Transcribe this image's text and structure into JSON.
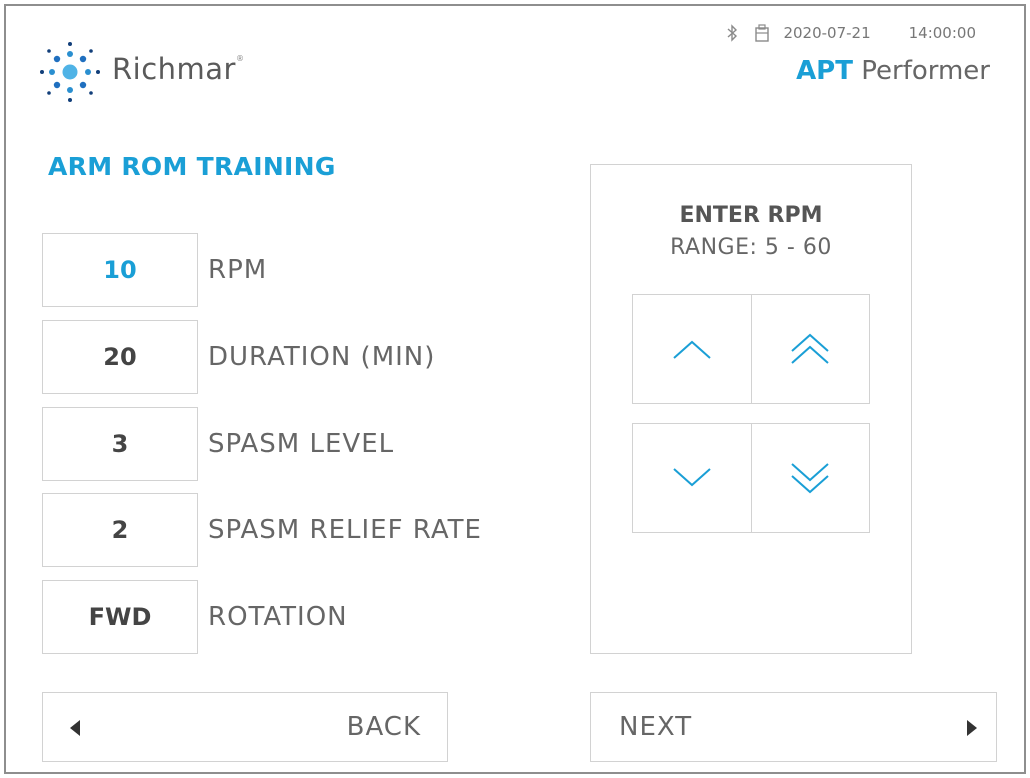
{
  "header": {
    "brand": "Richmar",
    "brand_mark": "®",
    "date": "2020-07-21",
    "time": "14:00:00",
    "product_bold": "APT",
    "product_rest": "Performer"
  },
  "page": {
    "title": "ARM ROM TRAINING"
  },
  "params": [
    {
      "value": "10",
      "label": "RPM"
    },
    {
      "value": "20",
      "label": "DURATION (MIN)"
    },
    {
      "value": "3",
      "label": "SPASM LEVEL"
    },
    {
      "value": "2",
      "label": "SPASM RELIEF RATE"
    },
    {
      "value": "FWD",
      "label": "ROTATION"
    }
  ],
  "entry_panel": {
    "title": "ENTER RPM",
    "range": "RANGE: 5 - 60"
  },
  "nav": {
    "back": "BACK",
    "next": "NEXT"
  },
  "icons": {
    "status": [
      "bluetooth-icon",
      "usb-drive-icon"
    ],
    "pad": [
      "chevron-up-icon",
      "double-chevron-up-icon",
      "chevron-down-icon",
      "double-chevron-down-icon"
    ],
    "nav": [
      "triangle-left-icon",
      "triangle-right-icon"
    ]
  },
  "colors": {
    "accent": "#1a9fd6",
    "text": "#666666",
    "border": "#d2d2d2"
  }
}
